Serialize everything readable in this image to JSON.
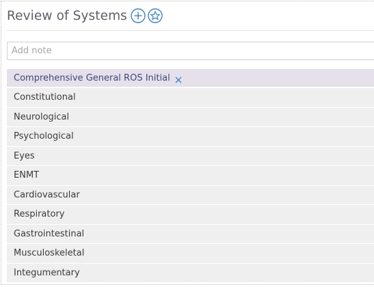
{
  "header": {
    "title": "Review of Systems"
  },
  "note": {
    "placeholder": "Add note",
    "value": ""
  },
  "group": {
    "label": "Comprehensive General ROS Initial"
  },
  "systems": [
    "Constitutional",
    "Neurological",
    "Psychological",
    "Eyes",
    "ENMT",
    "Cardiovascular",
    "Respiratory",
    "Gastrointestinal",
    "Musculoskeletal",
    "Integumentary"
  ],
  "colors": {
    "accent": "#3d7fc4",
    "group_bg": "#e5e0ea",
    "row_bg": "#efefef"
  },
  "icons": {
    "add": "plus-circle-icon",
    "favorite": "star-circle-icon",
    "remove": "close-icon"
  }
}
